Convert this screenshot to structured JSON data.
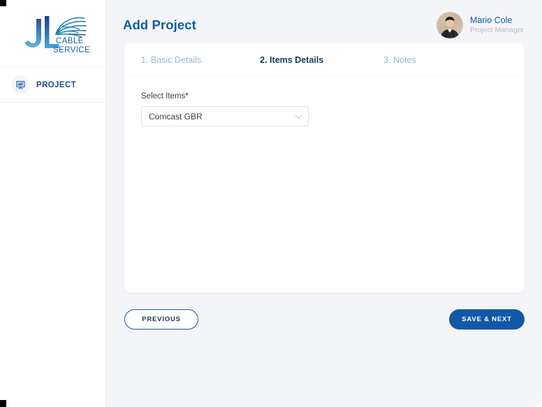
{
  "sidebar": {
    "logo": {
      "mark": "jl-monogram",
      "line1": "CABLE",
      "line2": "SERVICES",
      "alt": "JL Cable Services"
    },
    "items": [
      {
        "label": "PROJECT",
        "icon": "presentation-board-icon",
        "active": true
      }
    ]
  },
  "header": {
    "title": "Add Project",
    "user": {
      "name": "Mario Cole",
      "role": "Project Manager",
      "avatar": "user-photo"
    }
  },
  "card": {
    "tabs": [
      {
        "label": "1. Basic Details",
        "active": false
      },
      {
        "label": "2. Items Details",
        "active": true
      },
      {
        "label": "3. Notes",
        "active": false
      }
    ],
    "form": {
      "select_items": {
        "label": "Select Items*",
        "value": "Comcast GBR",
        "placeholder": "Select Items",
        "icon": "chevron-down-icon"
      }
    }
  },
  "footer": {
    "previous_label": "PREVIOUS",
    "save_next_label": "SAVE & NEXT"
  },
  "colors": {
    "accent": "#1258a8",
    "title": "#145ca4",
    "tab_active": "#12395f",
    "tab_inactive": "#9fb6cf",
    "canvas": "#f4f5f9",
    "card": "#ffffff",
    "role_text": "#b6bac4"
  }
}
